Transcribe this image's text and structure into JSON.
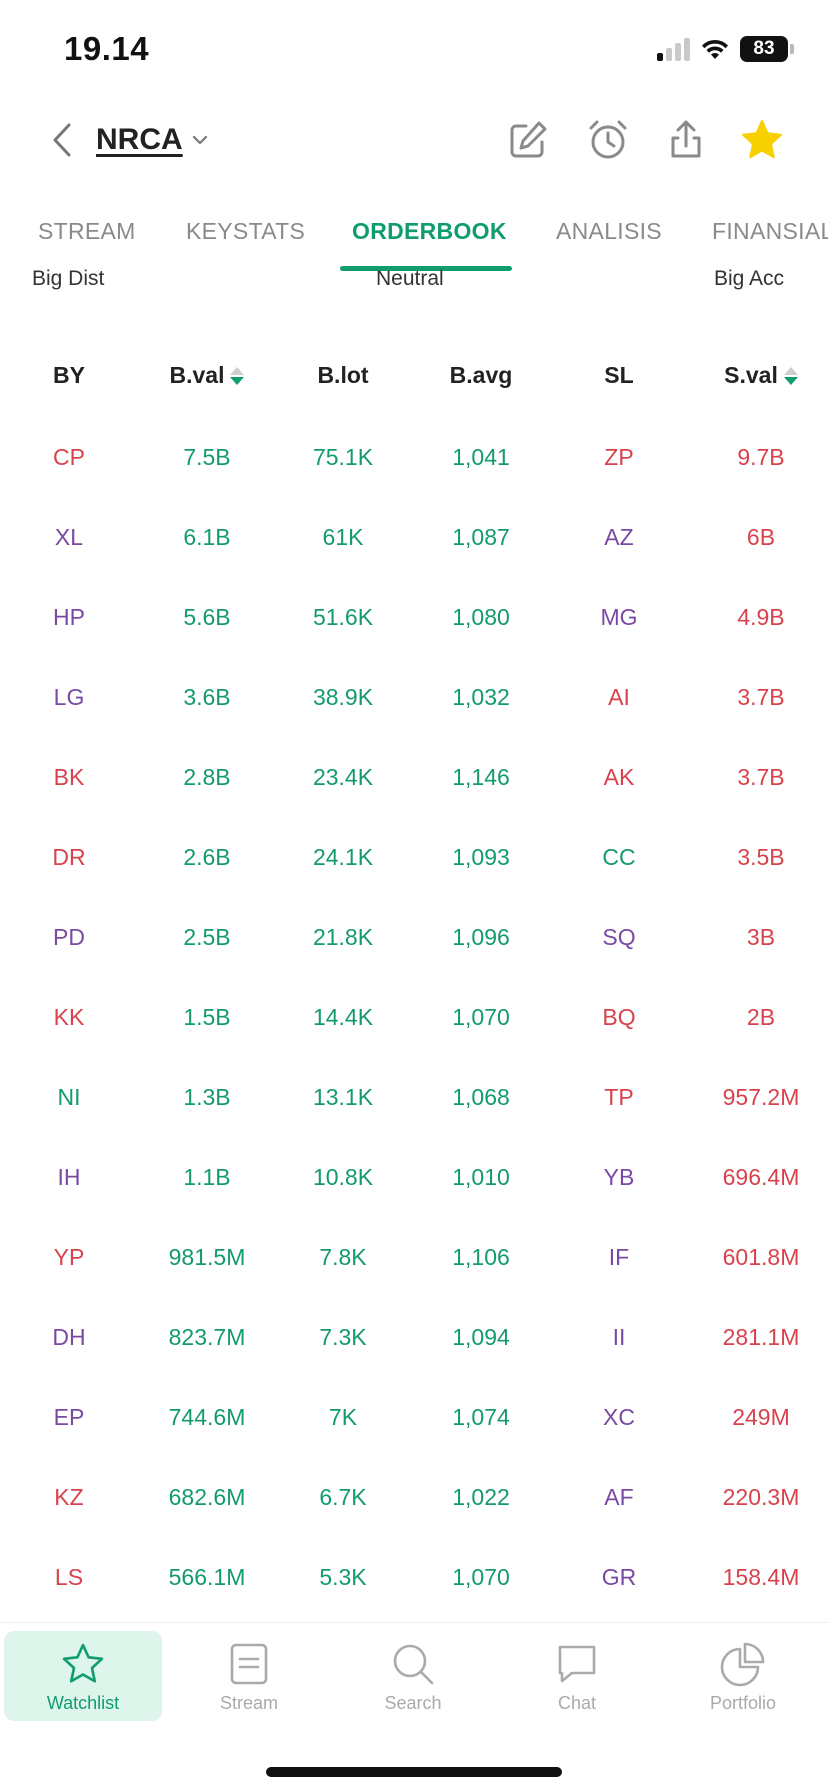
{
  "status_bar": {
    "time": "19.14",
    "battery": "83"
  },
  "header": {
    "ticker": "NRCA",
    "icons": [
      "edit-icon",
      "alarm-icon",
      "share-icon",
      "star-icon"
    ]
  },
  "tabs": [
    {
      "label": "STREAM",
      "active": false
    },
    {
      "label": "KEYSTATS",
      "active": false
    },
    {
      "label": "ORDERBOOK",
      "active": true
    },
    {
      "label": "ANALISIS",
      "active": false
    },
    {
      "label": "FINANSIAL",
      "active": false
    }
  ],
  "distribution": {
    "left": "Big Dist",
    "center": "Neutral",
    "right": "Big Acc"
  },
  "table": {
    "headers": [
      "BY",
      "B.val",
      "B.lot",
      "B.avg",
      "SL",
      "S.val"
    ],
    "rows": [
      {
        "by": "CP",
        "by_color": "red",
        "bval": "7.5B",
        "blot": "75.1K",
        "bavg": "1,041",
        "sl": "ZP",
        "sl_color": "red",
        "sval": "9.7B"
      },
      {
        "by": "XL",
        "by_color": "purple",
        "bval": "6.1B",
        "blot": "61K",
        "bavg": "1,087",
        "sl": "AZ",
        "sl_color": "purple",
        "sval": "6B"
      },
      {
        "by": "HP",
        "by_color": "purple",
        "bval": "5.6B",
        "blot": "51.6K",
        "bavg": "1,080",
        "sl": "MG",
        "sl_color": "purple",
        "sval": "4.9B"
      },
      {
        "by": "LG",
        "by_color": "purple",
        "bval": "3.6B",
        "blot": "38.9K",
        "bavg": "1,032",
        "sl": "AI",
        "sl_color": "red",
        "sval": "3.7B"
      },
      {
        "by": "BK",
        "by_color": "red",
        "bval": "2.8B",
        "blot": "23.4K",
        "bavg": "1,146",
        "sl": "AK",
        "sl_color": "red",
        "sval": "3.7B"
      },
      {
        "by": "DR",
        "by_color": "red",
        "bval": "2.6B",
        "blot": "24.1K",
        "bavg": "1,093",
        "sl": "CC",
        "sl_color": "green",
        "sval": "3.5B"
      },
      {
        "by": "PD",
        "by_color": "purple",
        "bval": "2.5B",
        "blot": "21.8K",
        "bavg": "1,096",
        "sl": "SQ",
        "sl_color": "purple",
        "sval": "3B"
      },
      {
        "by": "KK",
        "by_color": "red",
        "bval": "1.5B",
        "blot": "14.4K",
        "bavg": "1,070",
        "sl": "BQ",
        "sl_color": "red",
        "sval": "2B"
      },
      {
        "by": "NI",
        "by_color": "green",
        "bval": "1.3B",
        "blot": "13.1K",
        "bavg": "1,068",
        "sl": "TP",
        "sl_color": "red",
        "sval": "957.2M"
      },
      {
        "by": "IH",
        "by_color": "purple",
        "bval": "1.1B",
        "blot": "10.8K",
        "bavg": "1,010",
        "sl": "YB",
        "sl_color": "purple",
        "sval": "696.4M"
      },
      {
        "by": "YP",
        "by_color": "red",
        "bval": "981.5M",
        "blot": "7.8K",
        "bavg": "1,106",
        "sl": "IF",
        "sl_color": "purple",
        "sval": "601.8M"
      },
      {
        "by": "DH",
        "by_color": "purple",
        "bval": "823.7M",
        "blot": "7.3K",
        "bavg": "1,094",
        "sl": "II",
        "sl_color": "purple",
        "sval": "281.1M"
      },
      {
        "by": "EP",
        "by_color": "purple",
        "bval": "744.6M",
        "blot": "7K",
        "bavg": "1,074",
        "sl": "XC",
        "sl_color": "purple",
        "sval": "249M"
      },
      {
        "by": "KZ",
        "by_color": "red",
        "bval": "682.6M",
        "blot": "6.7K",
        "bavg": "1,022",
        "sl": "AF",
        "sl_color": "purple",
        "sval": "220.3M"
      },
      {
        "by": "LS",
        "by_color": "red",
        "bval": "566.1M",
        "blot": "5.3K",
        "bavg": "1,070",
        "sl": "GR",
        "sl_color": "purple",
        "sval": "158.4M"
      }
    ]
  },
  "bottom_nav": [
    {
      "label": "Watchlist",
      "icon": "star-outline-icon",
      "active": true
    },
    {
      "label": "Stream",
      "icon": "document-icon",
      "active": false
    },
    {
      "label": "Search",
      "icon": "search-icon",
      "active": false
    },
    {
      "label": "Chat",
      "icon": "chat-icon",
      "active": false
    },
    {
      "label": "Portfolio",
      "icon": "pie-chart-icon",
      "active": false
    }
  ],
  "colors": {
    "accent": "#0f9d6e",
    "green": "#139b6b",
    "red": "#d8424c",
    "purple": "#7a49a3",
    "star": "#f7d000"
  }
}
